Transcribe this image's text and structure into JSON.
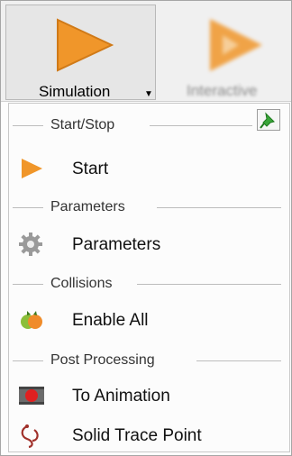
{
  "ribbon": {
    "simulation_label": "Simulation",
    "interactive_label": "Interactive"
  },
  "menu": {
    "sections": [
      {
        "title": "Start/Stop"
      },
      {
        "title": "Parameters"
      },
      {
        "title": "Collisions"
      },
      {
        "title": "Post Processing"
      }
    ],
    "items": [
      {
        "label": "Start",
        "icon": "play-icon"
      },
      {
        "label": "Parameters",
        "icon": "gear-icon"
      },
      {
        "label": "Enable All",
        "icon": "collision-icon"
      },
      {
        "label": "To Animation",
        "icon": "animation-icon"
      },
      {
        "label": "Solid Trace Point",
        "icon": "trace-icon"
      }
    ]
  },
  "colors": {
    "accent_orange": "#f0962a",
    "pin_green": "#3aa63a"
  }
}
